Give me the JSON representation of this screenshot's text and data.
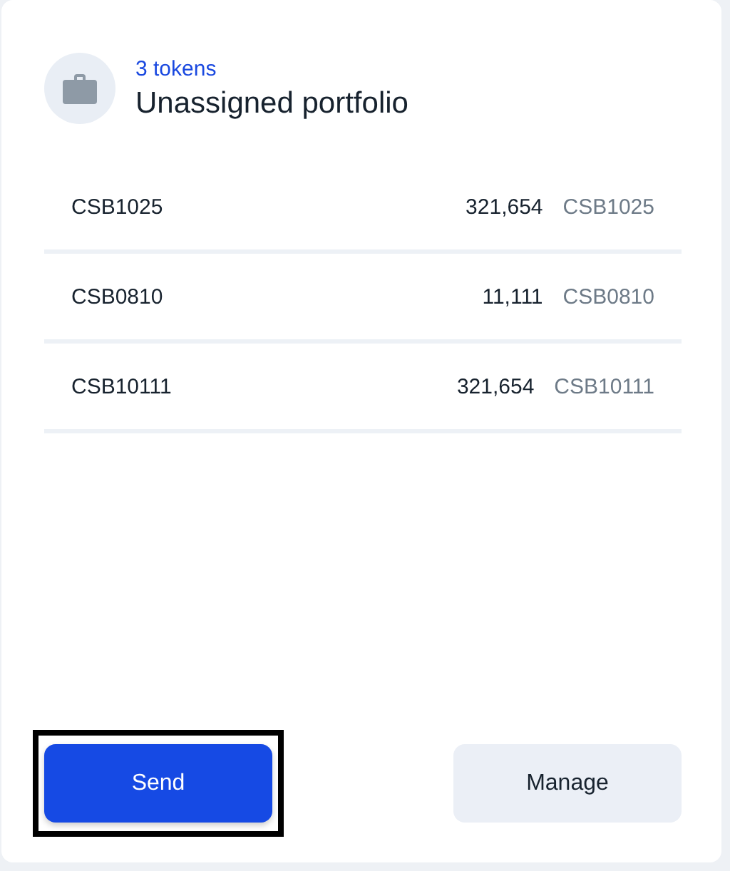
{
  "header": {
    "count": "3 tokens",
    "title": "Unassigned portfolio"
  },
  "tokens": [
    {
      "name": "CSB1025",
      "amount": "321,654",
      "symbol": "CSB1025"
    },
    {
      "name": "CSB0810",
      "amount": "11,111",
      "symbol": "CSB0810"
    },
    {
      "name": "CSB10111",
      "amount": "321,654",
      "symbol": "CSB10111"
    }
  ],
  "buttons": [
    {
      "label": "Send",
      "kind": "primary",
      "focused": true
    },
    {
      "label": "Manage",
      "kind": "secondary",
      "focused": false
    }
  ]
}
